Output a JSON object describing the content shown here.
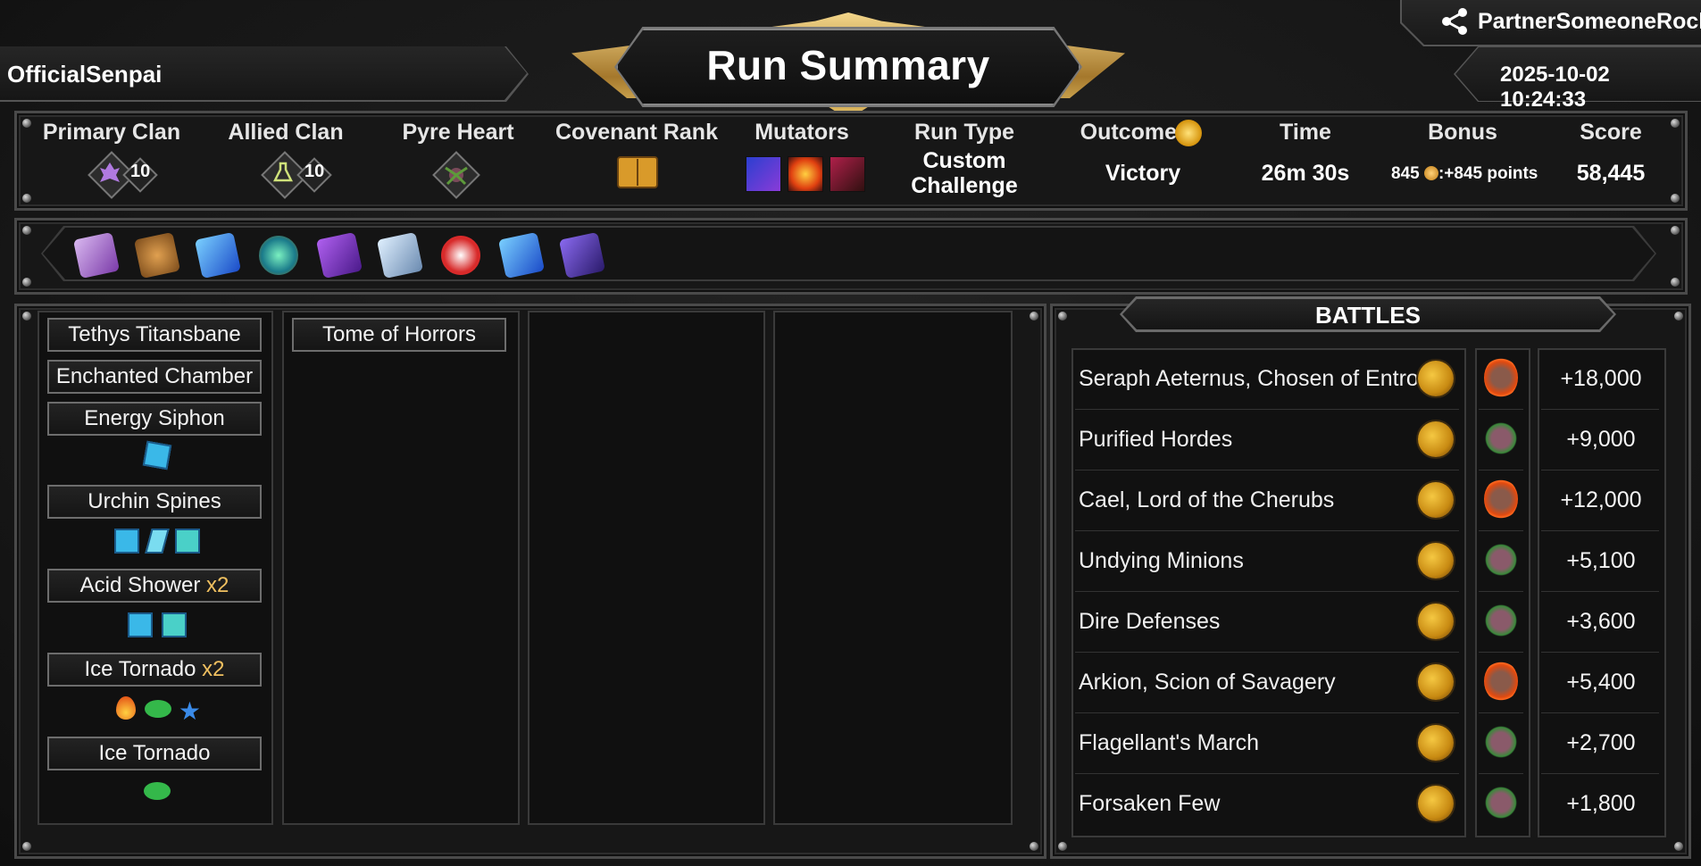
{
  "header": {
    "title": "Run Summary",
    "player": "OfficialSenpai",
    "partner": "PartnerSomeoneRocky",
    "datetime": "2025-10-02 10:24:33"
  },
  "stats": {
    "primary_clan": {
      "label": "Primary Clan",
      "level": "10"
    },
    "allied_clan": {
      "label": "Allied Clan",
      "level": "10"
    },
    "pyre_heart": {
      "label": "Pyre Heart"
    },
    "covenant_rank": {
      "label": "Covenant Rank"
    },
    "mutators": {
      "label": "Mutators"
    },
    "run_type": {
      "label": "Run Type",
      "value_line1": "Custom",
      "value_line2": "Challenge"
    },
    "outcome": {
      "label": "Outcome",
      "value": "Victory"
    },
    "time": {
      "label": "Time",
      "value": "26m 30s"
    },
    "bonus": {
      "label": "Bonus",
      "coins": "845",
      "points": ":+845 points"
    },
    "score": {
      "label": "Score",
      "value": "58,445"
    }
  },
  "relics": [
    "tome-icon",
    "net-icon",
    "blue-crystal-icon",
    "green-orb-icon",
    "purple-rune-icon",
    "ice-shards-icon",
    "jester-icon",
    "blue-crystal-icon",
    "purple-gem-icon"
  ],
  "deck": {
    "column1": [
      {
        "name": "Tethys Titansbane",
        "mult": ""
      },
      {
        "name": "Enchanted Chamber",
        "mult": ""
      },
      {
        "name": "Energy Siphon",
        "mult": ""
      },
      {
        "name": "Urchin Spines",
        "mult": ""
      },
      {
        "name": "Acid Shower",
        "mult": "x2"
      },
      {
        "name": "Ice Tornado",
        "mult": "x2"
      },
      {
        "name": "Ice Tornado",
        "mult": ""
      }
    ],
    "column2": [
      {
        "name": "Tome of Horrors"
      }
    ]
  },
  "battles": {
    "title": "BATTLES",
    "rows": [
      {
        "name": "Seraph Aeternus, Chosen of Entropy",
        "score": "+18,000",
        "boss": true
      },
      {
        "name": "Purified Hordes",
        "score": "+9,000",
        "boss": false
      },
      {
        "name": "Cael, Lord of the Cherubs",
        "score": "+12,000",
        "boss": true
      },
      {
        "name": "Undying Minions",
        "score": "+5,100",
        "boss": false
      },
      {
        "name": "Dire Defenses",
        "score": "+3,600",
        "boss": false
      },
      {
        "name": "Arkion, Scion of Savagery",
        "score": "+5,400",
        "boss": true
      },
      {
        "name": "Flagellant's March",
        "score": "+2,700",
        "boss": false
      },
      {
        "name": "Forsaken Few",
        "score": "+1,800",
        "boss": false
      }
    ]
  },
  "colors": {
    "gold": "#e9c66b",
    "multiplier": "#f0c060",
    "panel_border": "#4a4a4a"
  }
}
